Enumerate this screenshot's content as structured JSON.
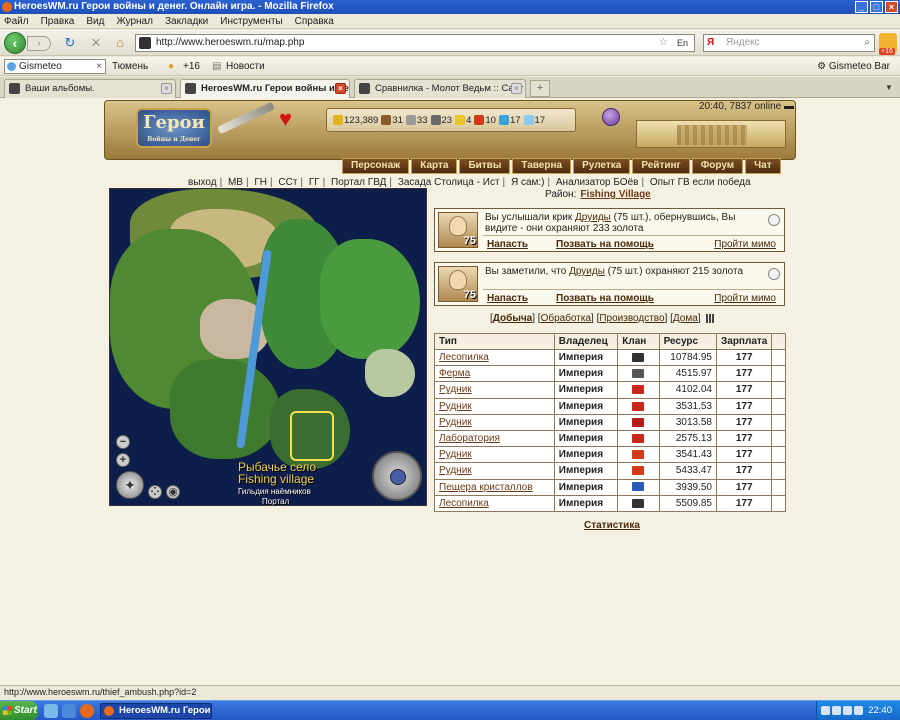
{
  "window": {
    "title": "HeroesWM.ru Герои войны и денег. Онлайн игра. - Mozilla Firefox"
  },
  "menu": [
    "Файл",
    "Правка",
    "Вид",
    "Журнал",
    "Закладки",
    "Инструменты",
    "Справка"
  ],
  "address": {
    "url": "http://www.heroeswm.ru/map.php",
    "lang_badge": "En"
  },
  "search": {
    "engine_glyph": "Я",
    "placeholder": "Яндекс"
  },
  "addon_badge": "+16",
  "gismeteo": {
    "input_value": "Gismeteo",
    "city": "Тюмень",
    "temp": "+16",
    "news": "Новости",
    "bar_label": "Gismeteo Bar"
  },
  "tabs": [
    {
      "label": "Ваши альбомы.",
      "active": false
    },
    {
      "label": "HeroesWM.ru Герои войны и ден...",
      "active": true
    },
    {
      "label": "Сравнилка - Молот Ведьм :: Сайт бо...",
      "active": false
    }
  ],
  "game": {
    "clock": "20:40, 7837 online",
    "resources": [
      {
        "value": "123,389",
        "color": "#E2B21E"
      },
      {
        "value": "31",
        "color": "#8A5A2A"
      },
      {
        "value": "33",
        "color": "#9A9A9A"
      },
      {
        "value": "23",
        "color": "#6A6A6A"
      },
      {
        "value": "4",
        "color": "#E8C52A"
      },
      {
        "value": "10",
        "color": "#D23A1A"
      },
      {
        "value": "17",
        "color": "#3AA2D8"
      },
      {
        "value": "17",
        "color": "#8AC8F0"
      }
    ],
    "nav": [
      "Персонаж",
      "Карта",
      "Битвы",
      "Таверна",
      "Рулетка",
      "Рейтинг",
      "Форум",
      "Чат"
    ],
    "links": [
      "выход",
      "МВ",
      "ГН",
      "ССт",
      "ГГ",
      "Портал ГВД",
      "Засада Столица - Ист",
      "Я сам:)",
      "Анализатор БОёв",
      "Опыт ГВ если победа"
    ],
    "district_label": "Район:",
    "district_name": "Fishing Village",
    "map": {
      "label_ru": "Рыбачье село",
      "label_en": "Fishing village",
      "guild": "Гильдия наёмников",
      "portal": "Портал"
    },
    "ambushes": [
      {
        "count": "75",
        "pre": "Вы услышали крик ",
        "creature": "Друиды",
        "post": " (75 шт.), обернувшись, Вы видите - они охраняют 233 золота",
        "attack": "Напасть",
        "help": "Позвать на помощь",
        "pass": "Пройти мимо"
      },
      {
        "count": "75",
        "pre": "Вы заметили, что ",
        "creature": "Друиды",
        "post": " (75 шт.) охраняют 215 золота",
        "attack": "Напасть",
        "help": "Позвать на помощь",
        "pass": "Пройти мимо"
      }
    ],
    "subtabs": [
      "Добыча",
      "Обработка",
      "Производство",
      "Дома"
    ],
    "table": {
      "headers": [
        "Тип",
        "Владелец",
        "Клан",
        "Ресурс",
        "Зарплата"
      ],
      "rows": [
        {
          "type": "Лесопилка",
          "owner": "Империя",
          "clan_color": "#333333",
          "resource": "10784.95",
          "salary": "177"
        },
        {
          "type": "Ферма",
          "owner": "Империя",
          "clan_color": "#555555",
          "resource": "4515.97",
          "salary": "177"
        },
        {
          "type": "Рудник",
          "owner": "Империя",
          "clan_color": "#C8281A",
          "resource": "4102.04",
          "salary": "177"
        },
        {
          "type": "Рудник",
          "owner": "Империя",
          "clan_color": "#C8281A",
          "resource": "3531.53",
          "salary": "177"
        },
        {
          "type": "Рудник",
          "owner": "Империя",
          "clan_color": "#B81A1A",
          "resource": "3013.58",
          "salary": "177"
        },
        {
          "type": "Лаборатория",
          "owner": "Империя",
          "clan_color": "#C8281A",
          "resource": "2575.13",
          "salary": "177"
        },
        {
          "type": "Рудник",
          "owner": "Империя",
          "clan_color": "#D23A1A",
          "resource": "3541.43",
          "salary": "177"
        },
        {
          "type": "Рудник",
          "owner": "Империя",
          "clan_color": "#D23A1A",
          "resource": "5433.47",
          "salary": "177"
        },
        {
          "type": "Пещера кристаллов",
          "owner": "Империя",
          "clan_color": "#2A5AB8",
          "resource": "3939.50",
          "salary": "177"
        },
        {
          "type": "Лесопилка",
          "owner": "Империя",
          "clan_color": "#333333",
          "resource": "5509.85",
          "salary": "177"
        }
      ]
    },
    "stats_link": "Статистика"
  },
  "status": {
    "text": "http://www.heroeswm.ru/thief_ambush.php?id=2"
  },
  "taskbar": {
    "start": "Start",
    "task": "HeroesWM.ru Герои в...",
    "time": "22:40",
    "lang": "RU"
  }
}
